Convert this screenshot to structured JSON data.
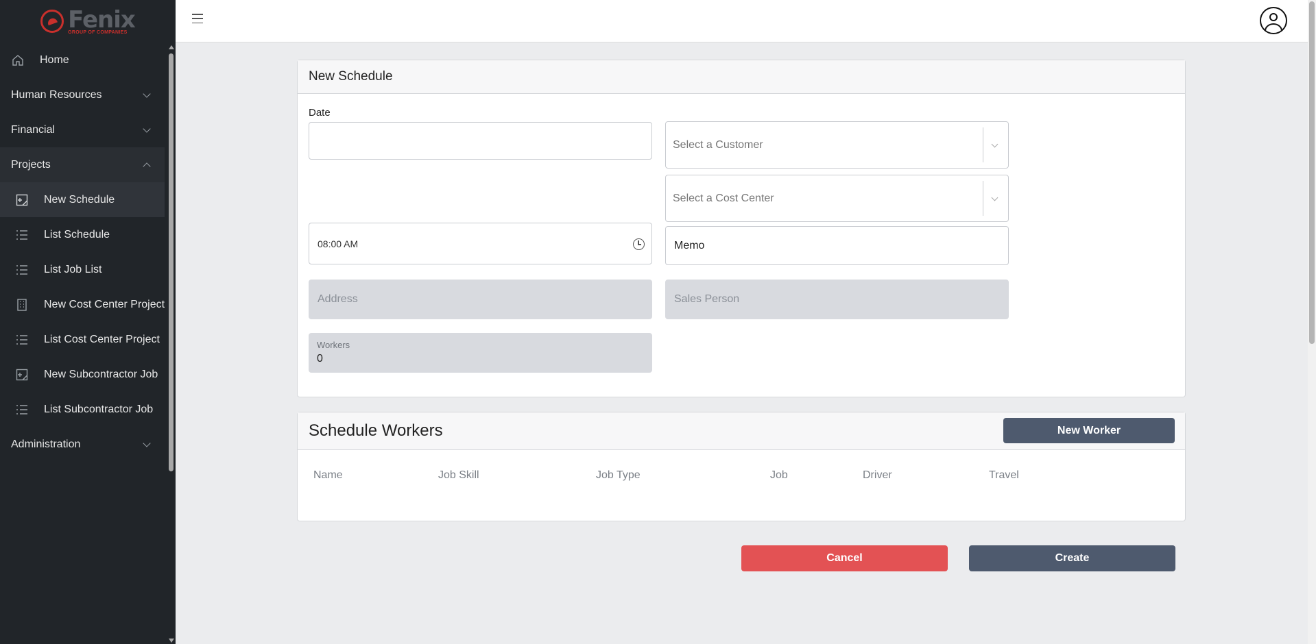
{
  "brand": {
    "name": "Fenix",
    "tagline": "GROUP OF COMPANIES"
  },
  "colors": {
    "sidebar_bg": "#212529",
    "primary_button": "#4e5a6e",
    "danger_button": "#e35254",
    "brand_red": "#c9302c"
  },
  "sidebar": {
    "items": [
      {
        "label": "Home",
        "icon": "home-icon",
        "type": "top"
      },
      {
        "label": "Human Resources",
        "type": "group",
        "expanded": false
      },
      {
        "label": "Financial",
        "type": "group",
        "expanded": false
      },
      {
        "label": "Projects",
        "type": "group",
        "expanded": true
      },
      {
        "label": "New Schedule",
        "icon": "new-document-icon",
        "type": "sub",
        "active": true
      },
      {
        "label": "List Schedule",
        "icon": "list-icon",
        "type": "sub"
      },
      {
        "label": "List Job List",
        "icon": "list-icon",
        "type": "sub"
      },
      {
        "label": "New Cost Center Project",
        "icon": "building-icon",
        "type": "sub"
      },
      {
        "label": "List Cost Center Project",
        "icon": "list-icon",
        "type": "sub"
      },
      {
        "label": "New Subcontractor Job",
        "icon": "new-document-icon",
        "type": "sub"
      },
      {
        "label": "List Subcontractor Job",
        "icon": "list-icon",
        "type": "sub"
      },
      {
        "label": "Administration",
        "type": "group",
        "expanded": false
      }
    ]
  },
  "schedule_form": {
    "title": "New Schedule",
    "date_label": "Date",
    "date_value": "",
    "customer_placeholder": "Select a Customer",
    "cost_center_placeholder": "Select a Cost Center",
    "time_value": "08:00 AM",
    "memo_placeholder": "Memo",
    "address_placeholder": "Address",
    "sales_person_placeholder": "Sales Person",
    "workers_label": "Workers",
    "workers_value": "0"
  },
  "schedule_workers": {
    "title": "Schedule Workers",
    "new_worker_label": "New Worker",
    "columns": [
      "Name",
      "Job Skill",
      "Job Type",
      "Job",
      "Driver",
      "Travel"
    ]
  },
  "actions": {
    "cancel_label": "Cancel",
    "create_label": "Create"
  }
}
